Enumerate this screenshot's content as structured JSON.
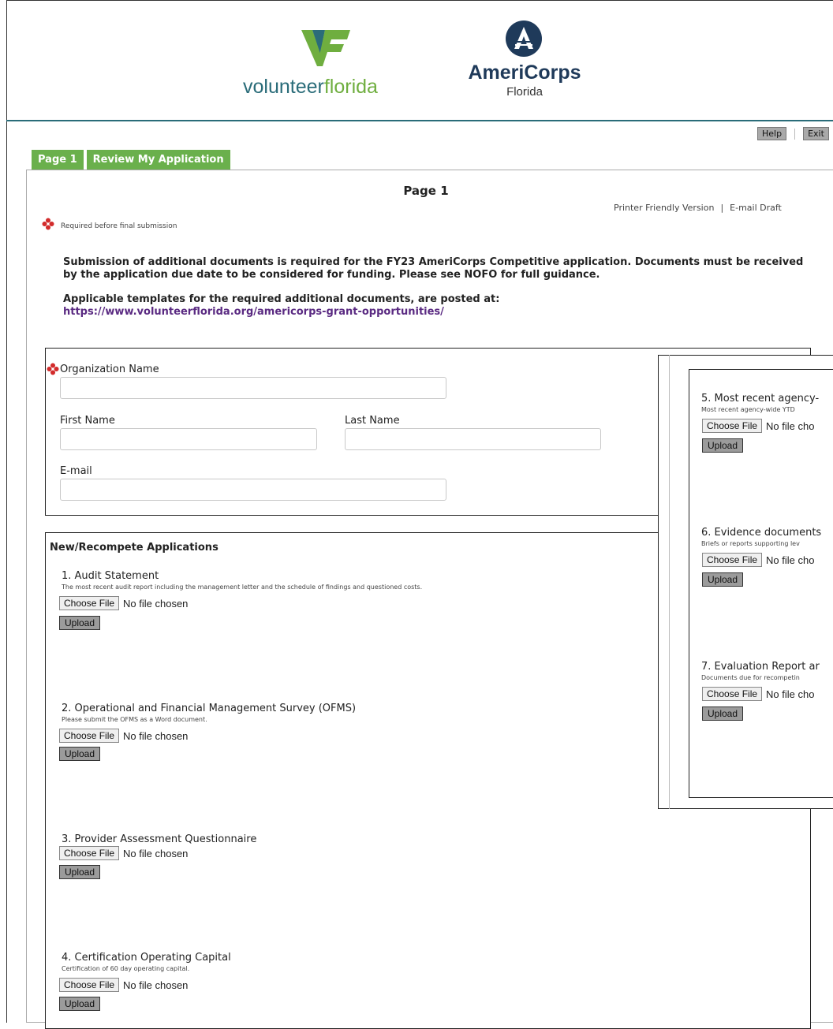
{
  "header": {
    "vf_logo_text_a": "volunteer",
    "vf_logo_text_b": "florida",
    "ac_logo_name": "AmeriCorps",
    "ac_logo_sub": "Florida",
    "help_label": "Help",
    "exit_label": "Exit"
  },
  "tabs": [
    {
      "label": "Page 1"
    },
    {
      "label": "Review My Application"
    }
  ],
  "page": {
    "title": "Page 1",
    "printer_link": "Printer Friendly Version",
    "separator": "|",
    "email_link": "E-mail Draft",
    "required_note": "Required before final submission",
    "intro_1": "Submission of additional documents is required for the FY23 AmeriCorps Competitive application. Documents must be received by the application due date to be considered for funding. Please see NOFO for full guidance.",
    "intro_2": "Applicable templates for the required additional documents, are posted at:",
    "intro_link": "https://www.volunteerflorida.org/americorps-grant-opportunities/"
  },
  "org": {
    "org_name_label": "Organization Name",
    "first_name_label": "First Name",
    "last_name_label": "Last Name",
    "email_label": "E-mail",
    "org_name_value": "",
    "first_name_value": "",
    "last_name_value": "",
    "email_value": ""
  },
  "apps": {
    "heading": "New/Recompete Applications",
    "choose_label": "Choose File",
    "no_file": "No file chosen",
    "upload_label": "Upload",
    "items": [
      {
        "title": "1. Audit Statement",
        "desc": "The most recent audit report including the management letter and the schedule of findings and questioned costs."
      },
      {
        "title": "2. Operational and Financial Management Survey (OFMS)",
        "desc": "Please submit the OFMS as a Word document."
      },
      {
        "title": "3. Provider Assessment Questionnaire",
        "desc": ""
      },
      {
        "title": "4. Certification Operating Capital",
        "desc": "Certification of 60 day operating capital."
      }
    ]
  },
  "overlay": {
    "no_file_trunc": "No file cho",
    "items": [
      {
        "title": "5. Most recent agency-",
        "desc": "Most recent agency-wide YTD"
      },
      {
        "title": "6. Evidence documents",
        "desc": "Briefs or reports supporting lev"
      },
      {
        "title": "7. Evaluation Report ar",
        "desc": "Documents due for recompetin"
      }
    ]
  },
  "colors": {
    "tab_green": "#6ab04c",
    "brand_teal": "#2a6c79",
    "brand_green": "#6fae3f",
    "americorps_navy": "#1f3a5a",
    "required_red": "#d22b2b",
    "link_purple": "#5a2a82"
  }
}
